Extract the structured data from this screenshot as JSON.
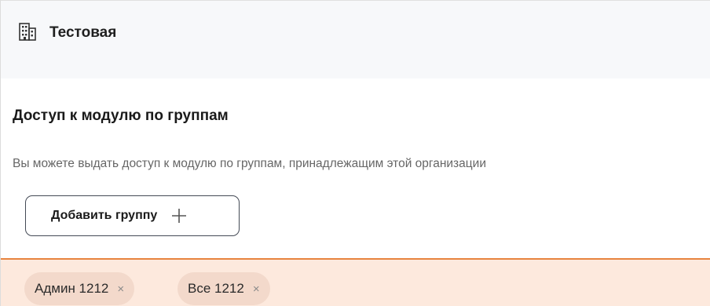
{
  "organization": {
    "title": "Тестовая",
    "icon": "building-icon"
  },
  "access_section": {
    "title": "Доступ к модулю по группам",
    "description": "Вы можете выдать доступ к модулю по группам, принадлежащим этой организации",
    "add_button_label": "Добавить группу",
    "add_button_icon": "plus-icon"
  },
  "groups": [
    {
      "label": "Админ 1212",
      "remove_symbol": "×"
    },
    {
      "label": "Все 1212",
      "remove_symbol": "×"
    }
  ],
  "colors": {
    "header_bg": "#f7f8fa",
    "groups_bar_bg": "#fde9dd",
    "groups_bar_accent": "#e8843f",
    "chip_bg": "#f3d9cb"
  }
}
